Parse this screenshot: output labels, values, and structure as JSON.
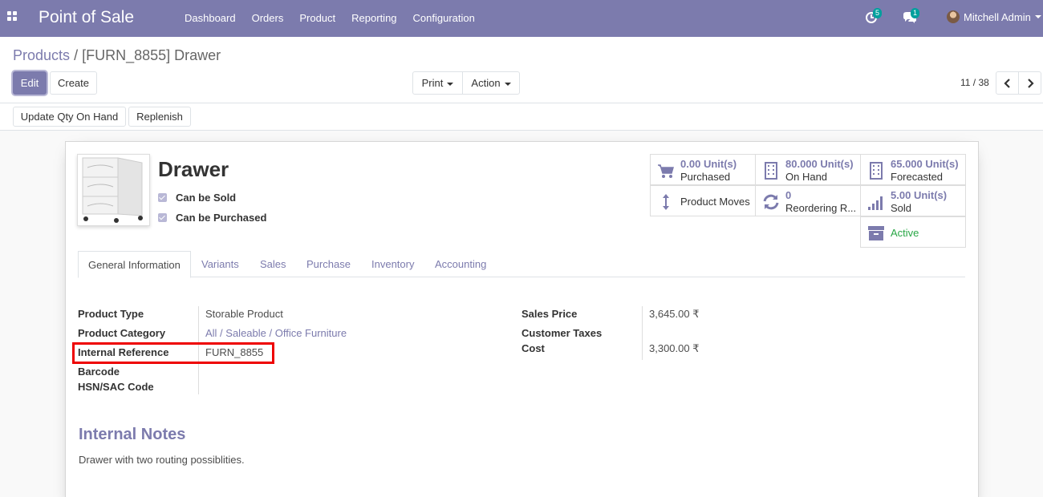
{
  "navbar": {
    "app_title": "Point of Sale",
    "menu": [
      "Dashboard",
      "Orders",
      "Product",
      "Reporting",
      "Configuration"
    ],
    "activity_count": "5",
    "message_count": "1",
    "user_name": "Mitchell Admin",
    "colors": {
      "navbar_bg": "#7c7bad",
      "badge": "#00a09d"
    }
  },
  "control": {
    "breadcrumb_parent": "Products",
    "breadcrumb_sep": "/",
    "breadcrumb_current": "[FURN_8855] Drawer",
    "edit_label": "Edit",
    "create_label": "Create",
    "print_label": "Print",
    "action_label": "Action",
    "pager": "11 / 38"
  },
  "statusbar": {
    "update_qty_label": "Update Qty On Hand",
    "replenish_label": "Replenish"
  },
  "product": {
    "name": "Drawer",
    "can_be_sold": "Can be Sold",
    "can_be_purchased": "Can be Purchased"
  },
  "smart_buttons": {
    "purchased_value": "0.00",
    "purchased_unit": "Unit(s)",
    "purchased_label": "Purchased",
    "onhand_value": "80.000",
    "onhand_unit": "Unit(s)",
    "onhand_label": "On Hand",
    "forecasted_value": "65.000",
    "forecasted_unit": "Unit(s)",
    "forecasted_label": "Forecasted",
    "moves_label": "Product Moves",
    "reordering_value": "0",
    "reordering_label": "Reordering R...",
    "sold_value": "5.00",
    "sold_unit": "Unit(s)",
    "sold_label": "Sold",
    "active_label": "Active",
    "colors": {
      "active": "#28a745",
      "accent": "#7c7bad"
    }
  },
  "tabs": [
    "General Information",
    "Variants",
    "Sales",
    "Purchase",
    "Inventory",
    "Accounting"
  ],
  "fields_left": {
    "product_type_label": "Product Type",
    "product_type_value": "Storable Product",
    "product_category_label": "Product Category",
    "product_category_value": "All / Saleable / Office Furniture",
    "internal_ref_label": "Internal Reference",
    "internal_ref_value": "FURN_8855",
    "barcode_label": "Barcode",
    "hsn_label": "HSN/SAC Code"
  },
  "fields_right": {
    "sales_price_label": "Sales Price",
    "sales_price_value": "3,645.00 ₹",
    "customer_taxes_label": "Customer Taxes",
    "cost_label": "Cost",
    "cost_value": "3,300.00 ₹"
  },
  "notes": {
    "title": "Internal Notes",
    "text": "Drawer with two routing possiblities."
  }
}
